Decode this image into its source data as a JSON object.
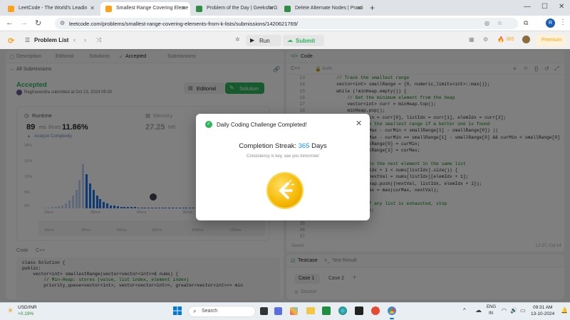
{
  "browser": {
    "tabs": [
      {
        "label": "LeetCode - The World's Leadin",
        "active": false
      },
      {
        "label": "Smallest Range Covering Eleme",
        "active": true
      },
      {
        "label": "Problem of the Day | GeeksforG",
        "active": false
      },
      {
        "label": "Delete Alternate Nodes | Practi",
        "active": false
      }
    ],
    "url": "leetcode.com/problems/smallest-range-covering-elements-from-k-lists/submissions/1420621769/",
    "profile_initial": "R"
  },
  "lc_nav": {
    "problem_list": "Problem List",
    "run": "Run",
    "submit": "Submit",
    "streak_count": "365",
    "premium": "Premium"
  },
  "left": {
    "tabs": [
      "Description",
      "Editorial",
      "Solutions",
      "Accepted",
      "Submissions"
    ],
    "all_submissions": "All Submissions",
    "status": "Accepted",
    "author_line": "Raghavendra submitted at Oct 13, 2024 09:30",
    "editorial_btn": "Editorial",
    "solution_btn": "Solution",
    "runtime_label": "Runtime",
    "runtime_value": "89",
    "runtime_unit": "ms",
    "beats_label": "Beats",
    "beats_value": "11.86%",
    "analyze": "Analyze Complexity",
    "memory_label": "Memory",
    "memory_value": "27.25",
    "memory_unit": "MB",
    "y_ticks": [
      "20%",
      "15%",
      "10%",
      "5%",
      "0%"
    ],
    "x_ticks": [
      "16ms",
      "38ms",
      "60ms",
      "82ms",
      "104ms"
    ],
    "x_ticks2": [
      "16ms",
      "38ms",
      "60ms",
      "82ms",
      "104ms",
      "126ms"
    ],
    "code_tabs": [
      "Code",
      "C++"
    ],
    "code_lines": [
      "class Solution {",
      "public:",
      "    vector<int> smallestRange(vector<vector<int>>& nums) {",
      "        // Min-Heap: stores (value, list index, element index)",
      "        priority_queue<vector<int>, vector<vector<int>>, greater<vector<int>>> min"
    ]
  },
  "chart_data": {
    "type": "bar",
    "x": [
      "16ms",
      "38ms",
      "60ms",
      "82ms",
      "104ms"
    ],
    "ylim": [
      0,
      20
    ],
    "values": [
      0.3,
      0.3,
      0.4,
      0.5,
      0.6,
      1,
      1.5,
      2.5,
      4,
      6,
      9,
      14,
      11,
      8,
      6,
      4,
      3,
      2,
      1.5,
      1,
      0.8,
      0.6,
      0.5,
      0.5,
      0.4,
      0.4,
      0.4,
      0.3,
      0.3,
      0.3,
      0.3,
      0.3,
      0.3,
      0.3,
      0.3,
      0.3,
      0.3,
      0.3,
      0.3,
      0.3,
      0.3,
      0.3,
      0.3,
      0.3,
      0.3,
      0.3,
      0.3,
      0.3,
      0.3,
      0.3,
      0.3,
      0.3,
      0.3,
      0.3,
      0.3,
      0.3,
      0.3,
      0.3,
      0.3,
      0.3,
      0.3,
      0.3,
      0.3
    ]
  },
  "right": {
    "code_label": "Code",
    "lang": "C++",
    "auto": "Auto",
    "line_numbers": [
      "13",
      "14",
      "15",
      "16",
      "17",
      "18",
      "19",
      "20",
      "21",
      "22",
      "23",
      "24",
      "25",
      "26",
      "27",
      "28",
      "29",
      "30",
      "31",
      "32",
      "33",
      "34",
      "35",
      "36",
      "37"
    ],
    "code_lines": [
      "        // Track the smallest range",
      "        vector<int> smallRange = {0, numeric_limits<int>::max()};",
      "",
      "        while (!minHeap.empty()) {",
      "            // Get the minimum element from the heap",
      "            vector<int> curr = minHeap.top();",
      "            minHeap.pop();",
      "            int curMin = curr[0], listIdx = curr[1], elemIdx = curr[2];",
      "",
      "            // Update the smallest range if a better one is found",
      "            if ((curMax - curMin < smallRange[1] - smallRange[0]) ||",
      "                (curMax - curMin == smallRange[1] - smallRange[0] && curMin < smallRange[0])) {",
      "                smallRange[0] = curMin;",
      "                smallRange[1] = curMax;",
      "            }",
      "",
      "            // Move to the next element in the same list",
      "            if (elemIdx + 1 < nums[listIdx].size()) {",
      "                int nextVal = nums[listIdx][elemIdx + 1];",
      "                minHeap.push({nextVal, listIdx, elemIdx + 1});",
      "                curMax = max(curMax, nextVal);",
      "            } else {",
      "                // If any list is exhausted, stop",
      "                break;",
      "            }"
    ],
    "saved": "Saved",
    "cursor": "Ln 27, Col 14"
  },
  "testcase": {
    "testcase_tab": "Testcase",
    "result_tab": "Test Result",
    "cases": [
      "Case 1",
      "Case 2"
    ],
    "add": "+",
    "source": "Source"
  },
  "modal": {
    "title": "Daily Coding Challenge Completed!",
    "streak_prefix": "Completion Streak:",
    "streak_value": "365",
    "streak_suffix": "Days",
    "subtitle": "Consistency is key, see you tomorrow!"
  },
  "taskbar": {
    "stock_name": "USD/INR",
    "stock_change": "+0.19%",
    "search": "Search",
    "lang1": "ENG",
    "lang2": "IN",
    "time": "09:31 AM",
    "date": "13-10-2024"
  },
  "colors": {
    "accent_green": "#2db55d",
    "leetcode_orange": "#ffa116",
    "streak_blue": "#1a90ff",
    "bar_blue": "#1a73e8"
  }
}
